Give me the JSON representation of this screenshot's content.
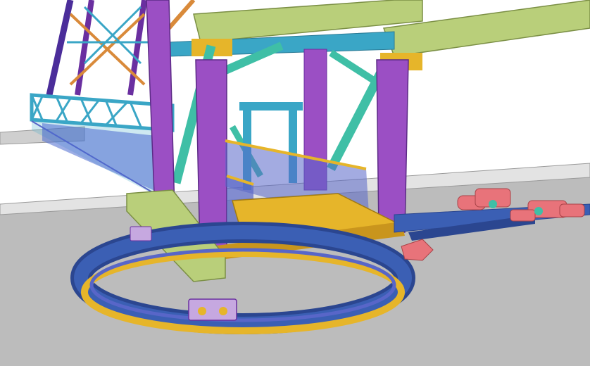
{
  "scene": {
    "description_text": "",
    "colors": {
      "background": "#ffffff",
      "ground": "#b9b9b9",
      "ground_far": "#c8c8c8",
      "wall": "#e0e0e0",
      "purple_column": "#9b4fc4",
      "purple_dark": "#6a2fa0",
      "cyan_truss": "#3aa6c6",
      "teal_brace": "#3fbfa6",
      "yellow_plate": "#e6b52a",
      "green_beam": "#b9cf7a",
      "blue_track": "#3b5fb4",
      "blue_track_dark": "#2b4690",
      "orange_member": "#d98a3a",
      "pink_motor": "#e8737a",
      "handrail_blue": "#5866c8"
    }
  }
}
